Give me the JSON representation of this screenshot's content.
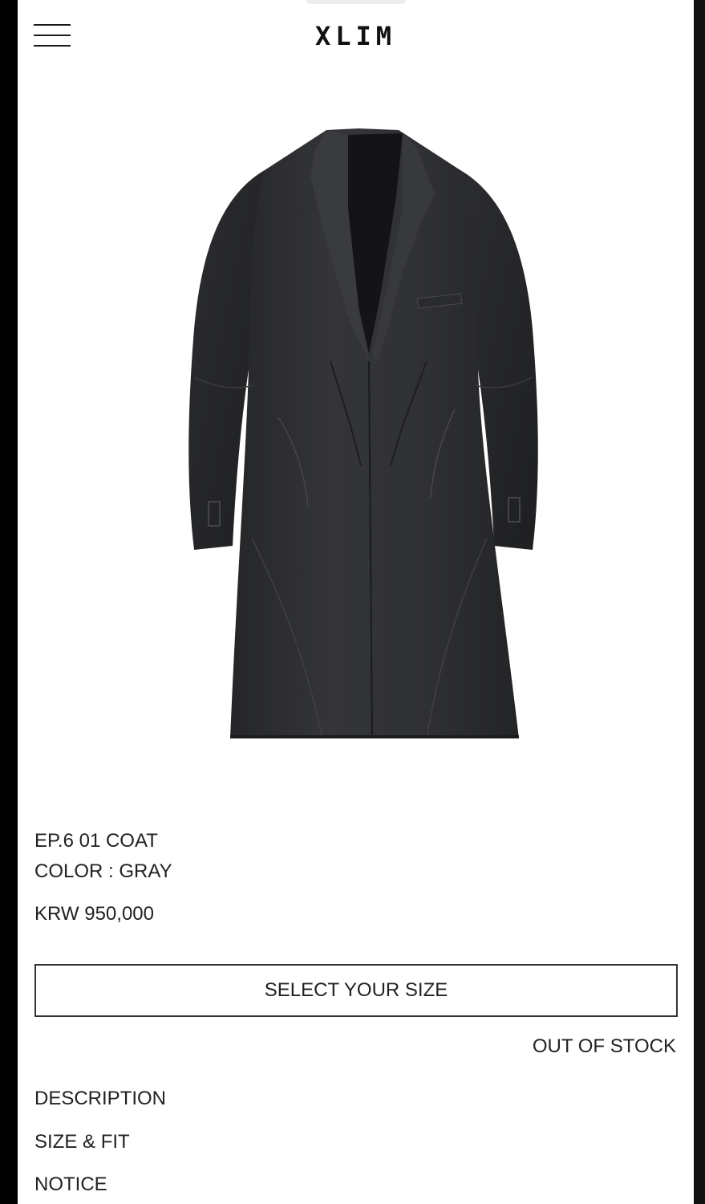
{
  "header": {
    "logo": "XLIM",
    "menu_icon": "hamburger-menu-icon"
  },
  "product": {
    "image_subject": "gray long coat",
    "title": "EP.6 01 COAT",
    "color": "COLOR : GRAY",
    "price": "KRW 950,000",
    "colors": {
      "coat": "#2f3032",
      "coat_shadow": "#1f2022",
      "coat_highlight": "#4a4b4e",
      "lining": "#141416"
    }
  },
  "purchase": {
    "size_select_label": "SELECT YOUR SIZE",
    "stock_status": "OUT OF STOCK"
  },
  "info_links": [
    {
      "label": "DESCRIPTION"
    },
    {
      "label": "SIZE & FIT"
    },
    {
      "label": "NOTICE"
    }
  ]
}
